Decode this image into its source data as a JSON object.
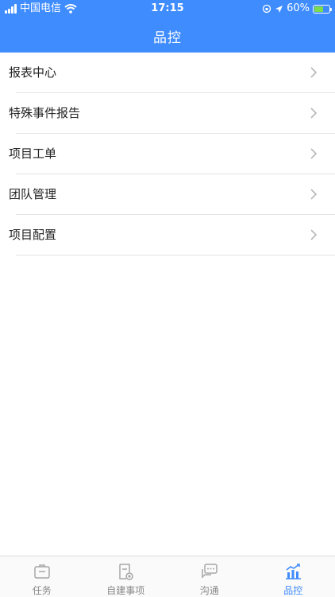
{
  "status_bar": {
    "carrier": "中国电信",
    "time": "17:15",
    "battery_percent": "60%",
    "battery_level": 0.6
  },
  "header": {
    "title": "品控"
  },
  "menu": {
    "items": [
      {
        "label": "报表中心"
      },
      {
        "label": "特殊事件报告"
      },
      {
        "label": "项目工单"
      },
      {
        "label": "团队管理"
      },
      {
        "label": "项目配置"
      }
    ]
  },
  "tabbar": {
    "active": "品控",
    "tabs": [
      {
        "label": "任务",
        "icon": "briefcase-icon"
      },
      {
        "label": "自建事项",
        "icon": "add-document-icon"
      },
      {
        "label": "沟通",
        "icon": "chat-icon"
      },
      {
        "label": "品控",
        "icon": "chart-icon"
      }
    ]
  },
  "colors": {
    "accent": "#3f8cff",
    "battery": "#7ddc4c",
    "inactive": "#888888"
  }
}
